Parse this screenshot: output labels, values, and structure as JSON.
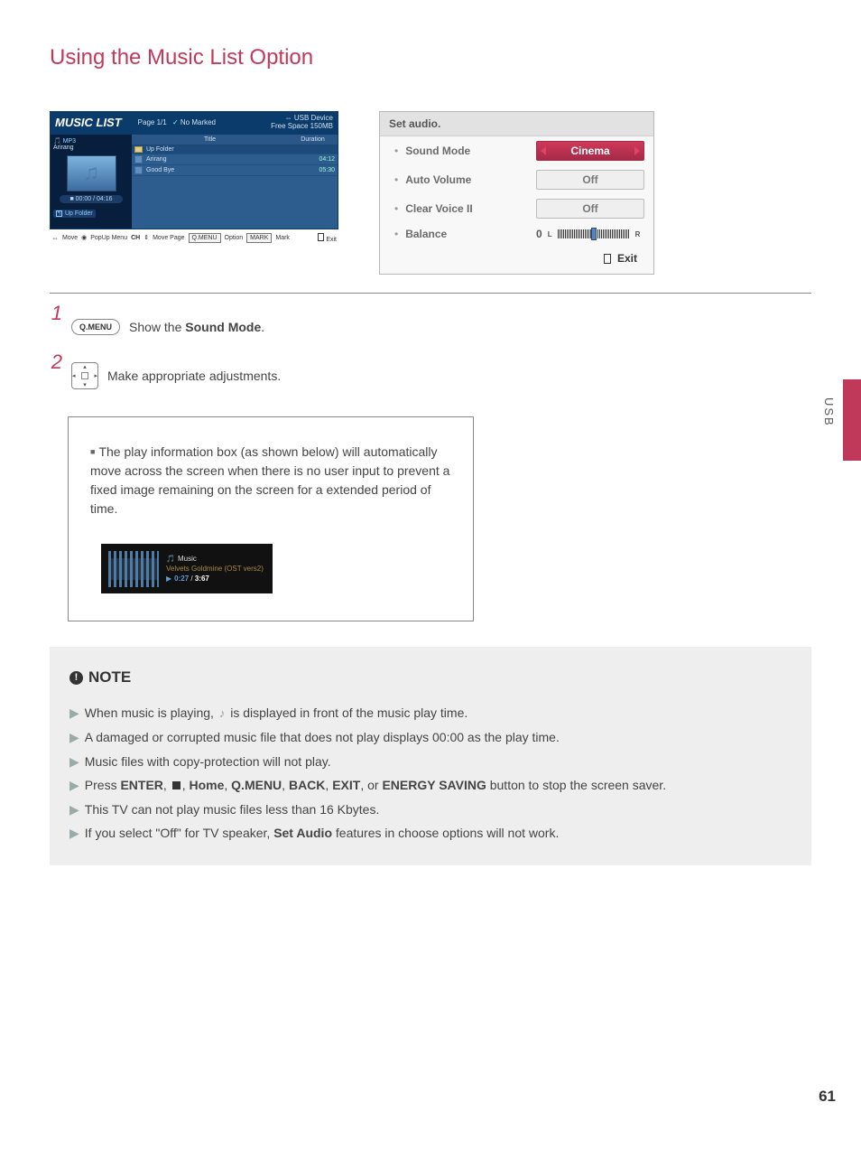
{
  "page": {
    "section_title": "Using the Music List Option",
    "side_tab": "USB",
    "page_number": "61"
  },
  "music_list": {
    "title": "MUSIC LIST",
    "page_info": "Page 1/1",
    "marked": "No Marked",
    "usb_device": "USB Device",
    "free_space": "Free Space 150MB",
    "left_mp3": "MP3",
    "left_album": "Arirang",
    "play_time": "00:00 / 04:16",
    "up_folder": "Up Folder",
    "col_title": "Title",
    "col_duration": "Duration",
    "rows": [
      {
        "name": "Up Folder",
        "duration": ""
      },
      {
        "name": "Arirang",
        "duration": "04:12"
      },
      {
        "name": "Good Bye",
        "duration": "05:30"
      }
    ],
    "footer": {
      "move": "Move",
      "popup": "PopUp Menu",
      "ch": "CH",
      "move_page": "Move Page",
      "qmenu": "Q.MENU",
      "option": "Option",
      "mark_btn": "MARK",
      "mark": "Mark",
      "exit": "Exit"
    }
  },
  "set_audio": {
    "title": "Set audio.",
    "rows": {
      "sound_mode": "Sound Mode",
      "auto_volume": "Auto Volume",
      "clear_voice": "Clear Voice II",
      "balance": "Balance"
    },
    "vals": {
      "sound_mode": "Cinema",
      "auto_volume": "Off",
      "clear_voice": "Off",
      "balance_num": "0",
      "balance_L": "L",
      "balance_R": "R"
    },
    "exit": "Exit"
  },
  "steps": {
    "s1_key": "Q.MENU",
    "s1_text_a": "Show the ",
    "s1_text_b": "Sound Mode",
    "s1_text_c": ".",
    "s2_text": "Make appropriate adjustments."
  },
  "info": {
    "text": "The play information box (as shown below) will automatically move across the screen when there is no user input to prevent a fixed image remaining on the screen for a extended period of time.",
    "pib": {
      "label": "Music",
      "track": "Velvets Goldmine (OST vers2)",
      "cur": "0:27",
      "sep": " / ",
      "tot": "3:67"
    }
  },
  "note": {
    "title": "NOTE",
    "lines": {
      "l1a": "When music is playing, ",
      "l1b": " is displayed in front of the music play time.",
      "l2": "A damaged or corrupted music file that does not play displays 00:00 as the play time.",
      "l3": "Music files with copy-protection will not play.",
      "l4a": "Press ",
      "l4_enter": "ENTER",
      "l4_sep": ", ",
      "l4_home": "Home",
      "l4_qmenu": "Q.MENU",
      "l4_back": "BACK",
      "l4_exit": "EXIT",
      "l4_or": ", or ",
      "l4_energy": "ENERGY SAVING",
      "l4b": " button to stop the screen saver.",
      "l5": "This TV can not play music files less than 16 Kbytes.",
      "l6a": "If you select \"Off\" for TV speaker, ",
      "l6_setaudio": "Set Audio",
      "l6b": " features in choose options will not work."
    }
  }
}
